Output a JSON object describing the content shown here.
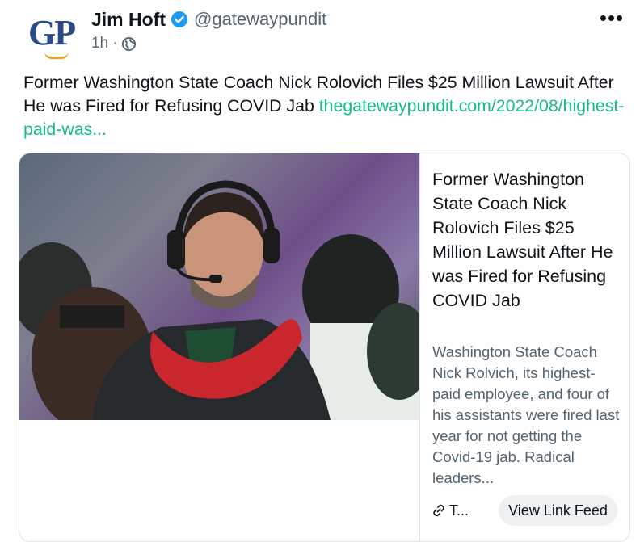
{
  "author": {
    "avatar_text": "GP",
    "name": "Jim Hoft",
    "handle": "@gatewaypundit",
    "time": "1h",
    "separator": "·"
  },
  "icons": {
    "verified": "verified-badge-icon",
    "globe": "globe-icon",
    "more": "more-options-icon",
    "link": "link-icon"
  },
  "colors": {
    "verified": "#1d9bf0",
    "link": "#17bd86",
    "avatar_text": "#2b4a8a",
    "avatar_accent": "#e8a12c"
  },
  "post": {
    "text": "Former Washington State Coach Nick Rolovich Files $25 Million Lawsuit After He was Fired for Refusing COVID Jab ",
    "link_text": "thegatewaypundit.com/2022/08/highest-paid-was..."
  },
  "card": {
    "title": "Former Washington State Coach Nick Rolovich Files $25 Million Lawsuit After He was Fired for Refusing COVID Jab",
    "description": "Washington State Coach Nick Rolvich, its highest-paid employee, and four of his assistants were fired last year for not getting the Covid-19 jab. Radical leaders...",
    "source": "T...",
    "button_label": "View Link Feed"
  }
}
